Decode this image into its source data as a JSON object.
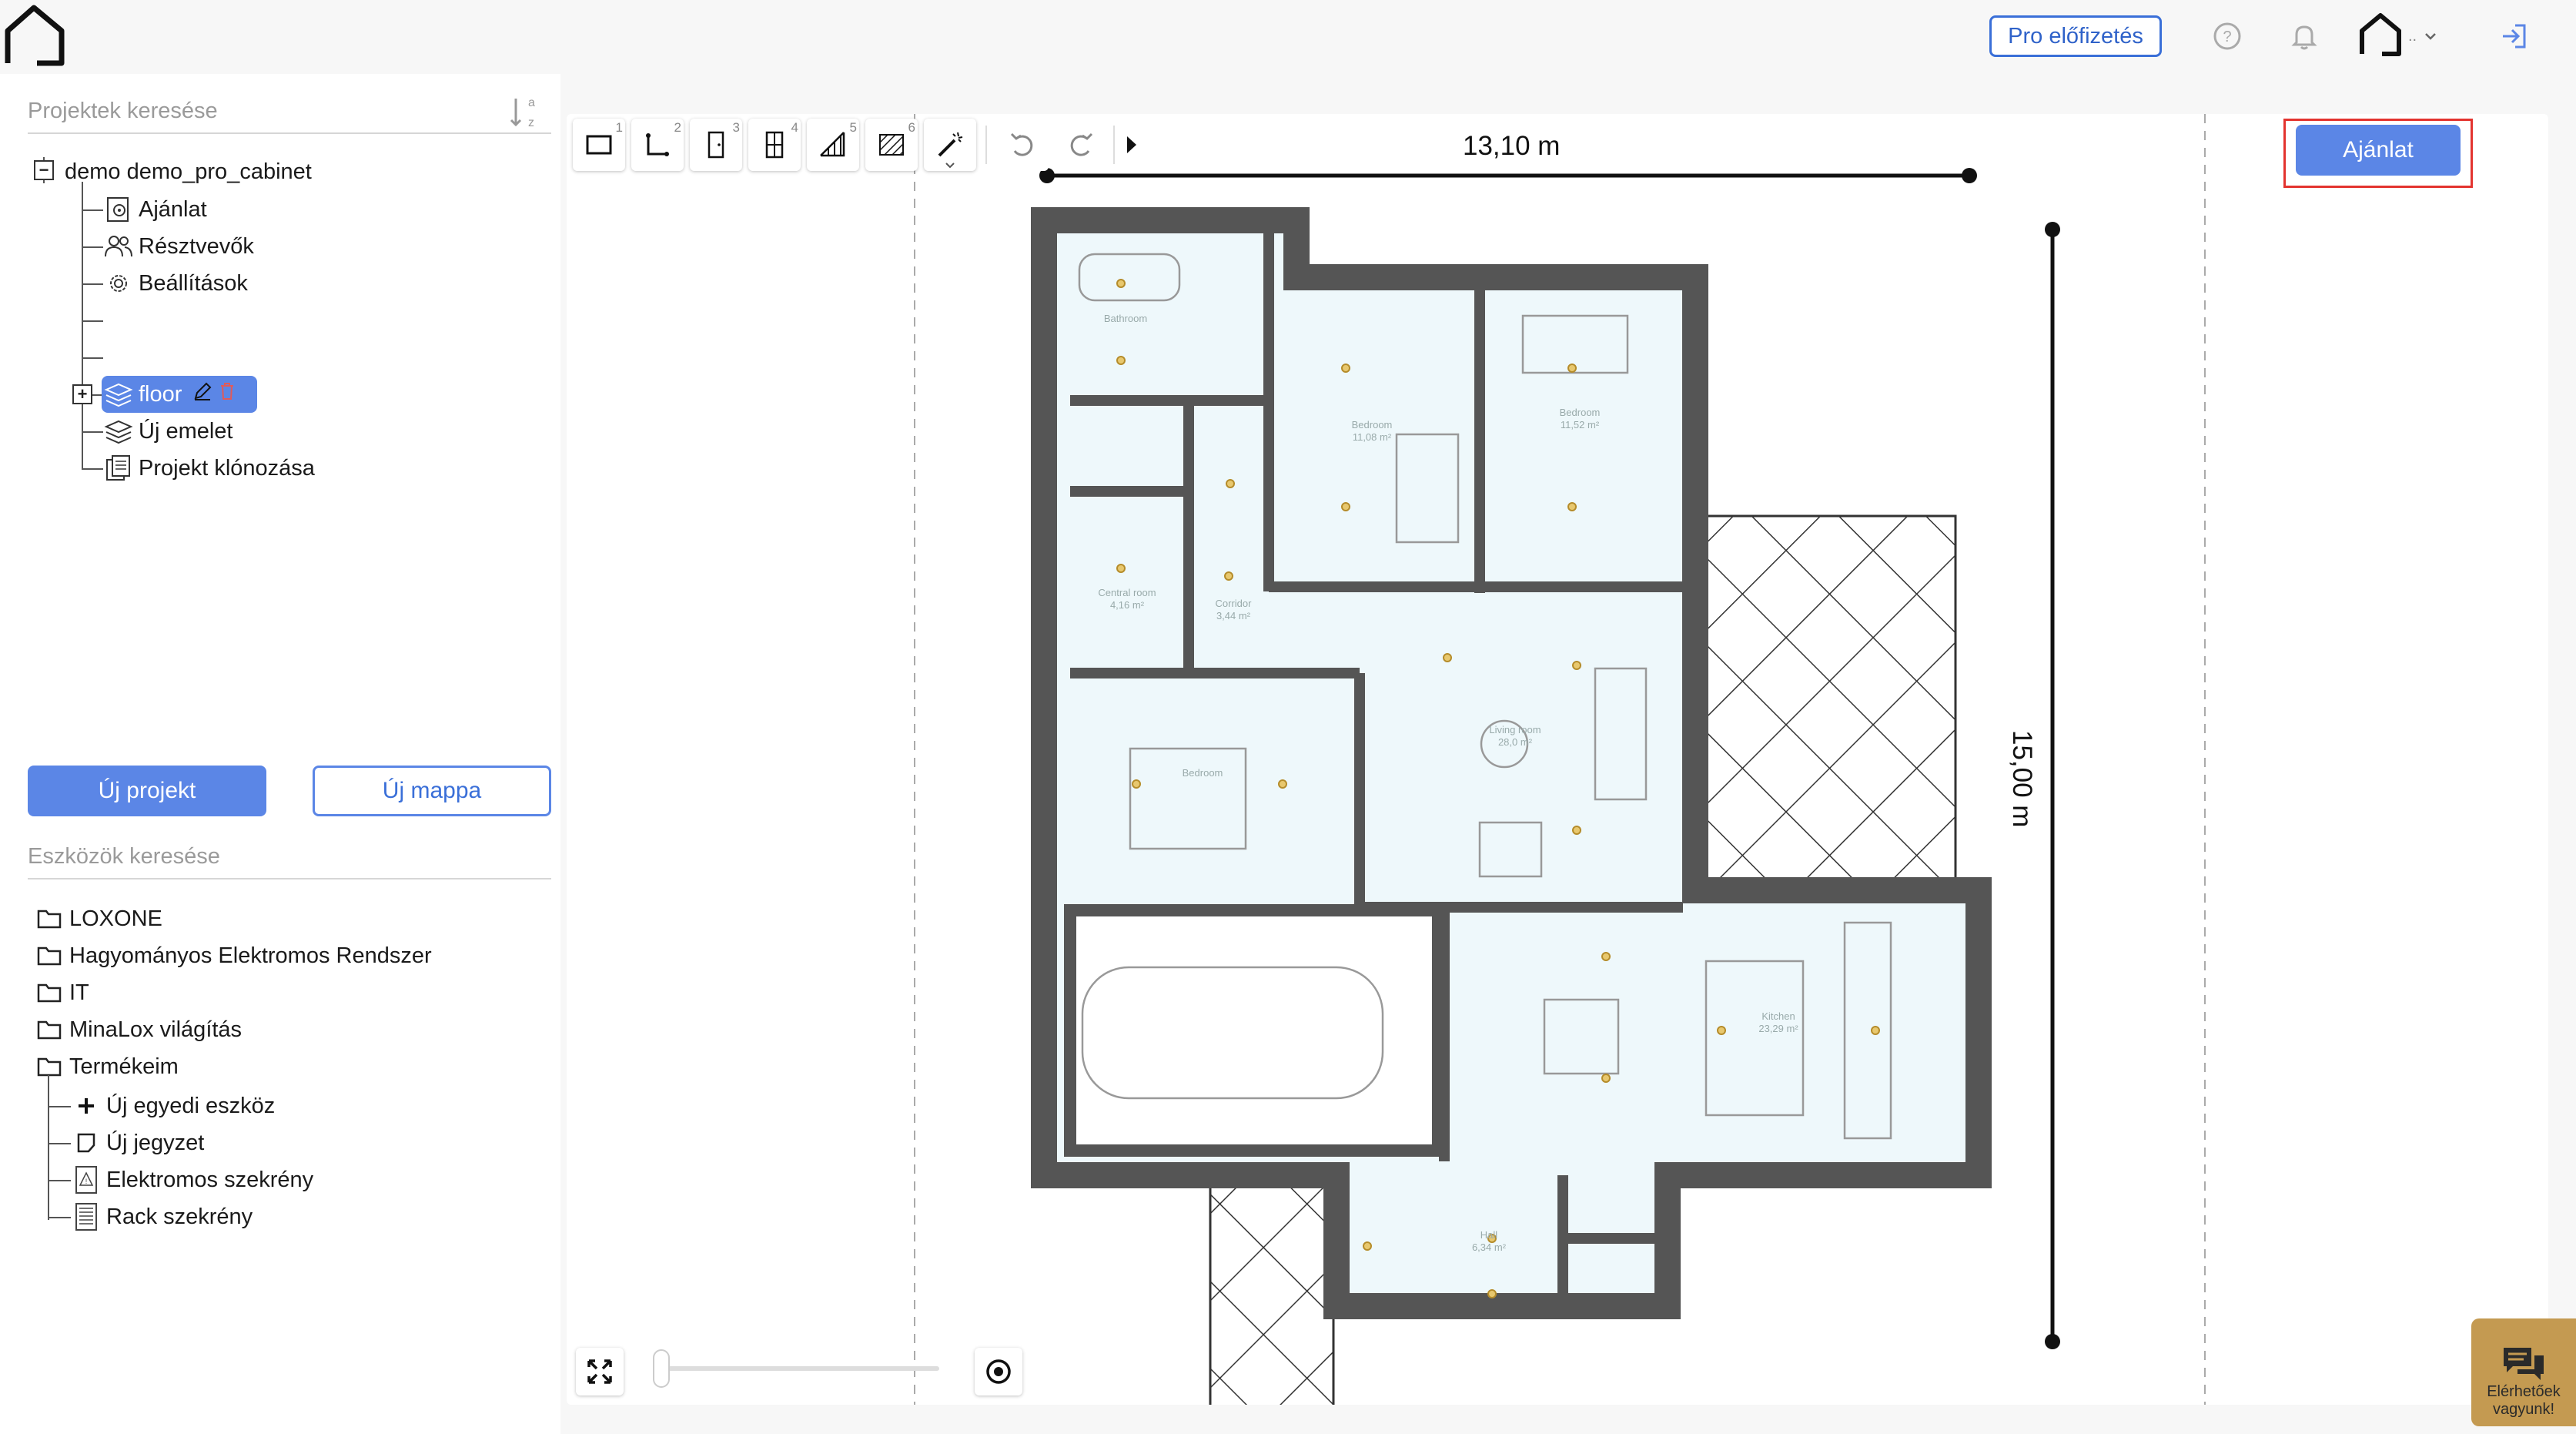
{
  "header": {
    "logo_icon": "house-icon",
    "pro_button_label": "Pro előfizetés",
    "help_icon": "question-circle-icon",
    "notification_icon": "bell-icon",
    "user_menu_icon": "house-icon",
    "user_menu_dots": "..",
    "logout_icon": "logout-icon"
  },
  "sidebar": {
    "project_search_placeholder": "Projektek keresése",
    "sort_icon": "sort-az-icon",
    "sort_glyph": "a z",
    "project_root": "demo demo_pro_cabinet",
    "project_items": [
      {
        "label": "Ajánlat",
        "icon": "offer-gear-icon"
      },
      {
        "label": "Résztvevők",
        "icon": "participants-icon"
      },
      {
        "label": "Beállítások",
        "icon": "gear-icon"
      },
      {
        "label": "floor",
        "icon": "layers-icon",
        "selected": true
      },
      {
        "label": "Új emelet",
        "icon": "add-layer-icon"
      },
      {
        "label": "Projekt klónozása",
        "icon": "clone-icon"
      }
    ],
    "new_project_label": "Új projekt",
    "new_folder_label": "Új mappa",
    "device_search_placeholder": "Eszközök keresése",
    "device_folders": [
      {
        "label": "LOXONE",
        "icon": "folder-icon"
      },
      {
        "label": "Hagyományos Elektromos Rendszer",
        "icon": "folder-icon"
      },
      {
        "label": "IT",
        "icon": "folder-icon"
      },
      {
        "label": "MinaLox világítás",
        "icon": "folder-icon"
      },
      {
        "label": "Termékeim",
        "icon": "folder-icon"
      }
    ],
    "my_products": [
      {
        "label": "Új egyedi eszköz",
        "icon": "plus-icon"
      },
      {
        "label": "Új jegyzet",
        "icon": "note-icon"
      },
      {
        "label": "Elektromos szekrény",
        "icon": "electrical-cabinet-icon"
      },
      {
        "label": "Rack szekrény",
        "icon": "rack-cabinet-icon"
      }
    ]
  },
  "toolbar": {
    "tools": [
      {
        "name": "rectangle-room-tool",
        "shortcut": "1"
      },
      {
        "name": "polygon-room-tool",
        "shortcut": "2"
      },
      {
        "name": "door-tool",
        "shortcut": "3"
      },
      {
        "name": "window-tool",
        "shortcut": "4"
      },
      {
        "name": "stairs-tool",
        "shortcut": "5"
      },
      {
        "name": "hatch-area-tool",
        "shortcut": "6"
      },
      {
        "name": "magic-wand-tool",
        "shortcut": ""
      }
    ],
    "undo_icon": "undo-icon",
    "redo_icon": "redo-icon",
    "expand_icon": "play-right-icon"
  },
  "plan": {
    "width_label": "13,10 m",
    "height_label": "15,00 m",
    "rooms": [
      {
        "name": "Bathroom",
        "area": ""
      },
      {
        "name": "Bedroom",
        "area": "11,08 m²"
      },
      {
        "name": "Bedroom",
        "area": "11,52 m²"
      },
      {
        "name": "Corridor",
        "area": "3,44 m²"
      },
      {
        "name": "Central room",
        "area": "4,16 m²"
      },
      {
        "name": "Bedroom",
        "area": ""
      },
      {
        "name": "Living room",
        "area": "28,0 m²"
      },
      {
        "name": "Kitchen",
        "area": "23,29 m²"
      },
      {
        "name": "Hall",
        "area": "6,34 m²"
      }
    ]
  },
  "offer_button_label": "Ajánlat",
  "canvas_controls": {
    "fit_icon": "fullscreen-arrows-icon",
    "center_icon": "target-icon"
  },
  "chat": {
    "icon": "chat-bubbles-icon",
    "label_line1": "Elérhetőek",
    "label_line2": "vagyunk!"
  },
  "colors": {
    "accent": "#5b86e6",
    "highlight_frame": "#e3342f",
    "chat_background": "#c49a51",
    "wall": "#555555",
    "room_fill": "#eef8fb"
  }
}
